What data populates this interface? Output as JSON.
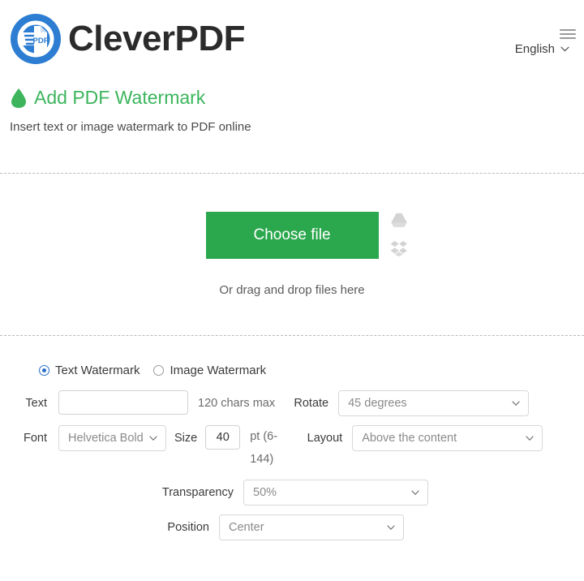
{
  "header": {
    "brand_name": "CleverPDF",
    "logo_badge": "PDF",
    "language": "English",
    "lang_caret_icon": "chevron-down-icon",
    "menu_icon": "hamburger-menu-icon"
  },
  "title_section": {
    "icon": "water-drop-icon",
    "title": "Add PDF Watermark",
    "subtitle": "Insert text or image watermark to PDF online"
  },
  "upload": {
    "choose_file_label": "Choose file",
    "drag_text": "Or drag and drop files here",
    "google_drive_icon": "google-drive-icon",
    "dropbox_icon": "dropbox-icon"
  },
  "watermark_type": {
    "options": [
      {
        "label": "Text Watermark",
        "selected": true
      },
      {
        "label": "Image Watermark",
        "selected": false
      }
    ]
  },
  "form": {
    "text": {
      "label": "Text",
      "value": "",
      "placeholder": "",
      "hint": "120 chars max"
    },
    "rotate": {
      "label": "Rotate",
      "value": "45 degrees"
    },
    "font": {
      "label": "Font",
      "value": "Helvetica Bold"
    },
    "size": {
      "label": "Size",
      "value": "40",
      "unit_hint_line1": "pt (6-",
      "unit_hint_line2": "144)"
    },
    "layout": {
      "label": "Layout",
      "value": "Above the content"
    },
    "transparency": {
      "label": "Transparency",
      "value": "50%"
    },
    "position": {
      "label": "Position",
      "value": "Center"
    }
  },
  "colors": {
    "brand_blue": "#2d7dd2",
    "accent_green": "#2ba84e",
    "title_green": "#3cb55c",
    "text_dark": "#333333",
    "muted": "#8a8a8a",
    "divider": "#b9b9b9"
  }
}
